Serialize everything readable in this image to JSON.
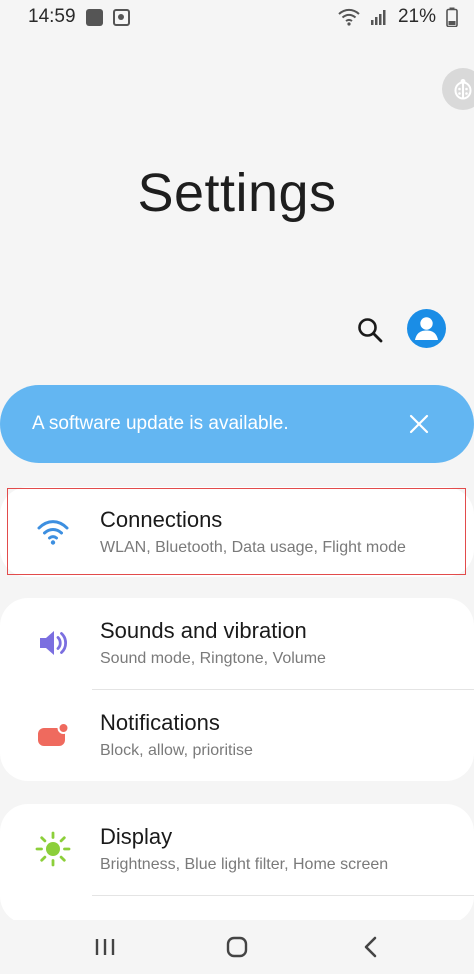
{
  "status_bar": {
    "time": "14:59",
    "battery": "21%"
  },
  "page": {
    "title": "Settings"
  },
  "banner": {
    "text": "A software update is available."
  },
  "settings": [
    {
      "title": "Connections",
      "subtitle": "WLAN, Bluetooth, Data usage, Flight mode",
      "icon": "wifi-icon",
      "icon_color": "#3d8fe0"
    },
    {
      "title": "Sounds and vibration",
      "subtitle": "Sound mode, Ringtone, Volume",
      "icon": "speaker-icon",
      "icon_color": "#7b6fe0"
    },
    {
      "title": "Notifications",
      "subtitle": "Block, allow, prioritise",
      "icon": "notification-icon",
      "icon_color": "#ef6a5e"
    },
    {
      "title": "Display",
      "subtitle": "Brightness, Blue light filter, Home screen",
      "icon": "sun-icon",
      "icon_color": "#8ccf3a"
    }
  ],
  "colors": {
    "accent_blue": "#1a8de6",
    "banner_blue": "#63b6f2",
    "highlight_red": "#e24b4b"
  },
  "nav": {
    "recents_icon": "recents-icon",
    "home_icon": "home-icon",
    "back_icon": "back-icon"
  }
}
